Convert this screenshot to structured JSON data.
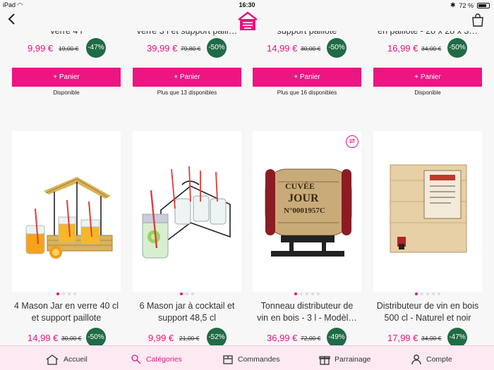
{
  "status": {
    "device": "iPad",
    "time": "16:30",
    "battery": "72 %"
  },
  "top_row": [
    {
      "title": "verre 4 l",
      "price": "9,99 €",
      "old_price": "19,00 €",
      "discount": "-47%",
      "button": "+ Panier",
      "availability": "Disponible"
    },
    {
      "title": "verre 3 l et support paill…",
      "price": "39,99 €",
      "old_price": "79,80 €",
      "discount": "-50%",
      "button": "+ Panier",
      "availability": "Plus que 13 disponibles"
    },
    {
      "title": "support paillote",
      "price": "14,99 €",
      "old_price": "30,00 €",
      "discount": "-50%",
      "button": "+ Panier",
      "availability": "Plus que 16 disponibles"
    },
    {
      "title": "en paillote - 28 x 28 x 3…",
      "price": "16,99 €",
      "old_price": "34,00 €",
      "discount": "-50%",
      "button": "+ Panier",
      "availability": "Disponible"
    }
  ],
  "bottom_row": [
    {
      "title1": "4 Mason Jar en verre 40 cl",
      "title2": "et support paillote",
      "price": "14,99 €",
      "old_price": "30,00 €",
      "discount": "-50%"
    },
    {
      "title1": "6 Mason jar à cocktail et",
      "title2": "support 48,5 cl",
      "price": "9,99 €",
      "old_price": "21,00 €",
      "discount": "-52%"
    },
    {
      "title1": "Tonneau distributeur de",
      "title2": "vin en bois - 3 l - Modèl…",
      "price": "36,99 €",
      "old_price": "72,00 €",
      "discount": "-49%"
    },
    {
      "title1": "Distributeur de vin en bois",
      "title2": "500 cl - Naturel et noir",
      "price": "17,99 €",
      "old_price": "34,00 €",
      "discount": "-47%"
    }
  ],
  "tabs": [
    {
      "label": "Accueil"
    },
    {
      "label": "Catégories"
    },
    {
      "label": "Commandes"
    },
    {
      "label": "Parrainage"
    },
    {
      "label": "Compte"
    }
  ],
  "colors": {
    "accent": "#ec1582",
    "discount_badge": "#1f6b46",
    "tabbar_bg": "#fde9f2"
  }
}
